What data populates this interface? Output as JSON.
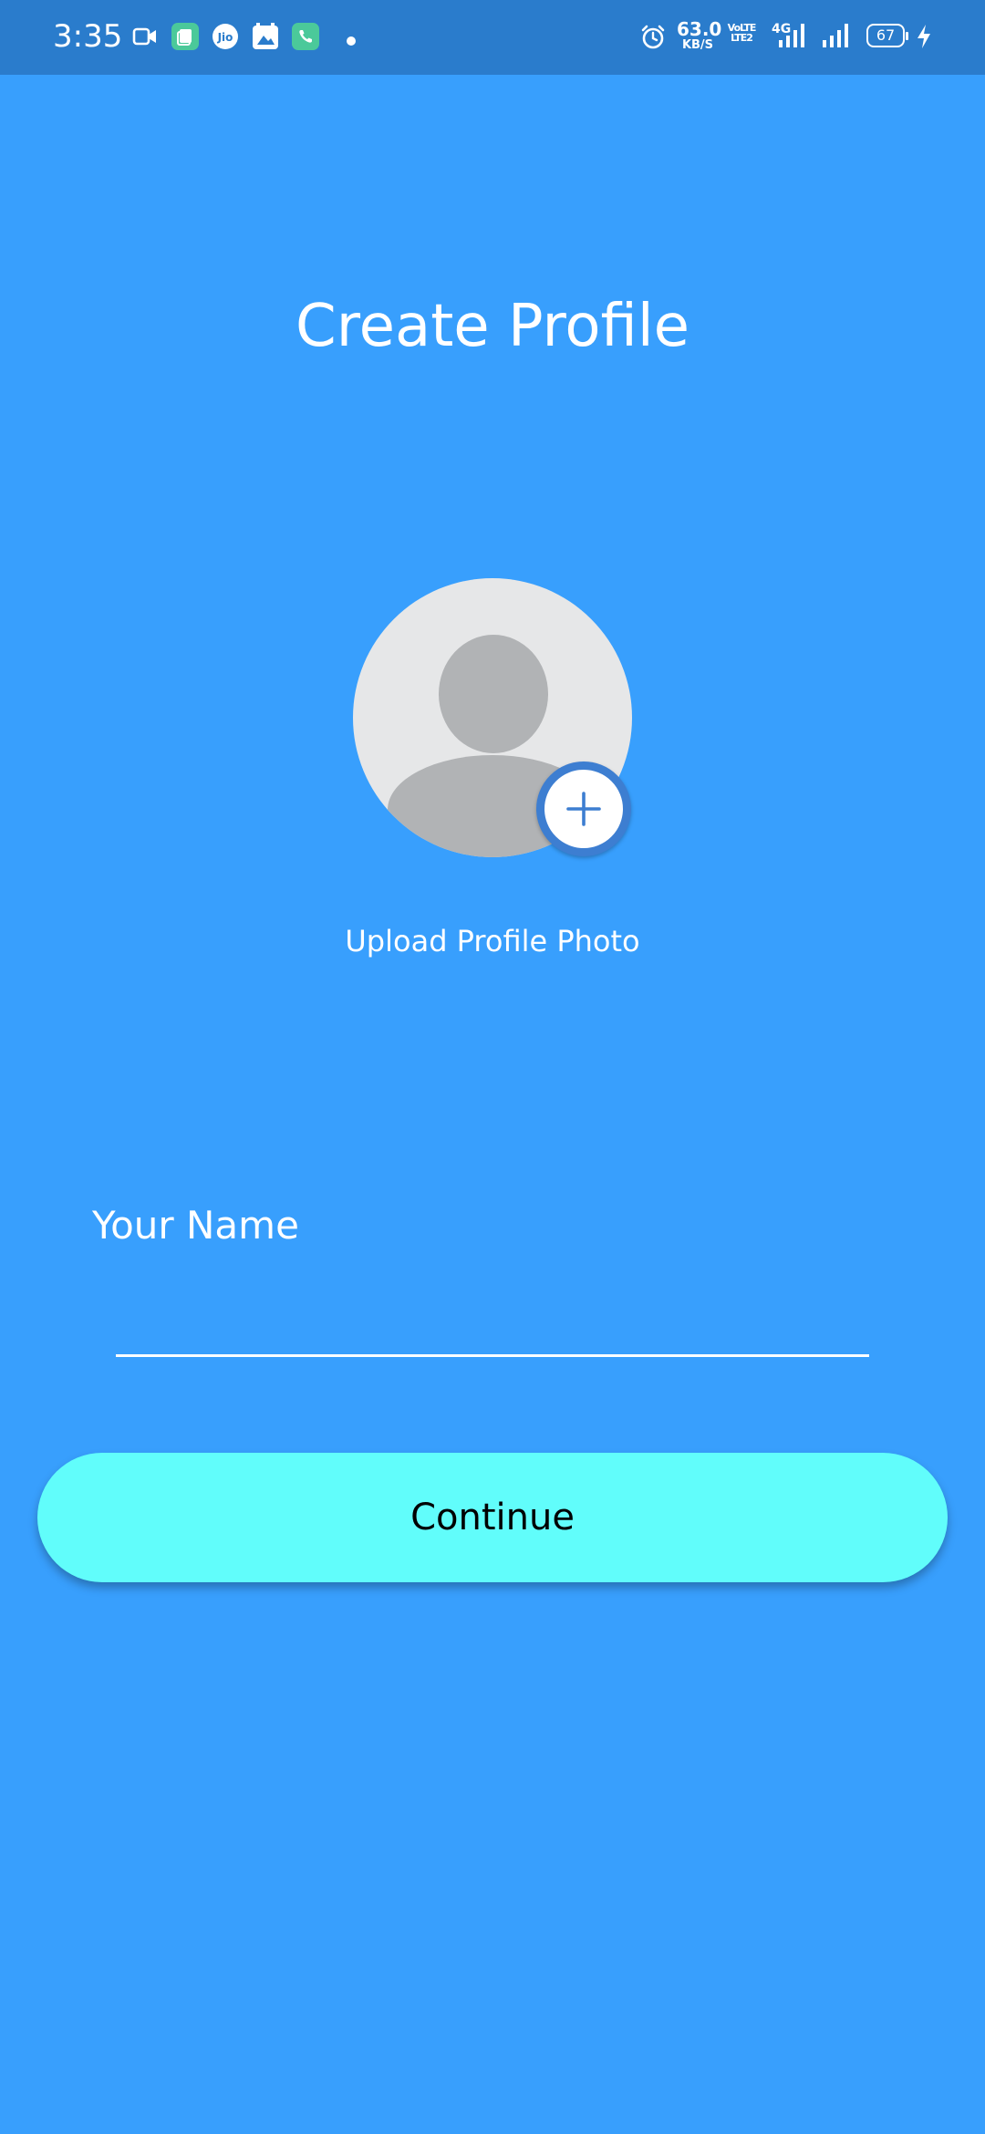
{
  "status_bar": {
    "time": "3:35",
    "network_speed": "63.0",
    "network_speed_unit": "KB/S",
    "volte_top": "VoLTE",
    "volte_bottom": "LTE2",
    "network_type": "4G",
    "battery": "67",
    "icons": [
      "video-camera-icon",
      "multitask-app-icon",
      "jio-icon",
      "gallery-app-icon",
      "phone-call-icon",
      "dot-icon",
      "alarm-icon",
      "signal-icon",
      "signal-icon",
      "battery-icon",
      "charging-icon"
    ]
  },
  "header": {
    "title": "Create Profile"
  },
  "profile_photo": {
    "upload_label": "Upload Profile Photo",
    "add_icon": "plus-icon"
  },
  "form": {
    "name_label": "Your Name",
    "name_value": "",
    "name_placeholder": ""
  },
  "actions": {
    "continue_label": "Continue"
  },
  "colors": {
    "background": "#389ffd",
    "status_bar": "#2a7ccc",
    "button": "#61fdfb",
    "add_button_ring": "#3d7ed1",
    "avatar_bg": "#e6e7e8",
    "avatar_silhouette": "#b1b3b5"
  }
}
